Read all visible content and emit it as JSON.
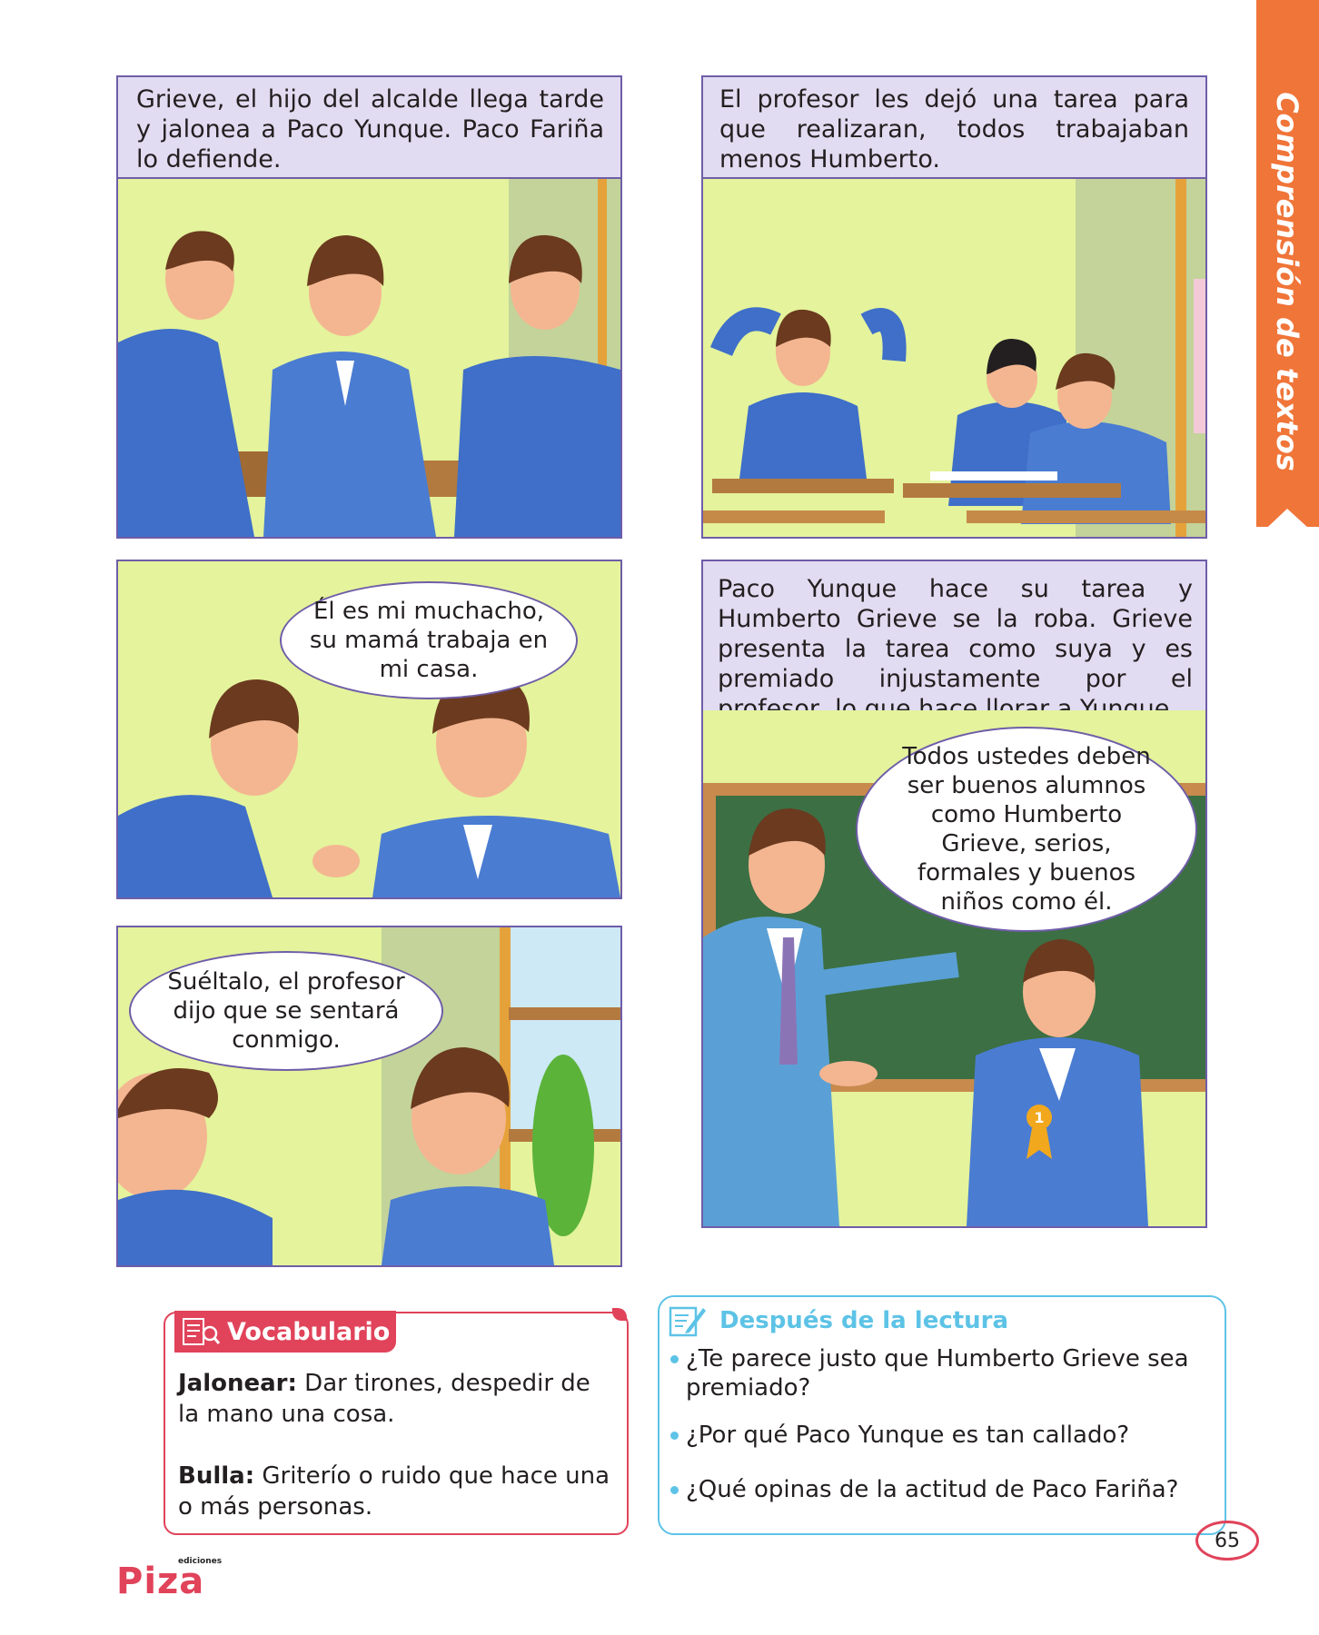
{
  "side_tab": {
    "label": "Comprensión de textos"
  },
  "panels": {
    "p1": {
      "caption": "Grieve, el hijo del alcalde llega tarde y jalonea a Paco Yunque. Paco Fariña lo defiende."
    },
    "p2": {
      "caption": "El profesor les dejó una tarea para que realizaran, todos trabajaban menos Humberto."
    },
    "p3": {
      "bubble": "Él es mi muchacho, su mamá trabaja en mi casa."
    },
    "p4": {
      "bubble": "Suéltalo, el profesor dijo que se sentará conmigo."
    },
    "p5": {
      "caption": "Paco Yunque hace su tarea y Humberto Grieve se la roba. Grieve presenta la tarea como suya y es premiado injustamente por el profesor, lo que hace llorar a Yunque.",
      "bubble": "Todos ustedes deben ser buenos alumnos como Humberto Grieve, serios, formales y buenos niños como él.",
      "medal": "1"
    }
  },
  "vocabulario": {
    "title": "Vocabulario",
    "entries": [
      {
        "term": "Jalonear:",
        "definition": " Dar tirones, despedir de la mano una cosa."
      },
      {
        "term": "Bulla:",
        "definition": " Griterío o ruido que hace una o más personas."
      }
    ]
  },
  "despues": {
    "title": "Después de la lectura",
    "questions": [
      "¿Te parece justo que Humberto Grieve sea premiado?",
      "¿Por qué Paco Yunque es tan callado?",
      "¿Qué opinas de la actitud de Paco Fariña?"
    ]
  },
  "footer": {
    "brand_small": "ediciones",
    "brand": "Piza",
    "page_number": "65"
  },
  "colors": {
    "accent_orange": "#f07539",
    "panel_border": "#6f5da8",
    "caption_bg": "#e2dcf2",
    "wall": "#e4f39c",
    "uniform": "#3f6fc8",
    "vocab_red": "#e0435a",
    "after_blue": "#5dc3e6"
  }
}
